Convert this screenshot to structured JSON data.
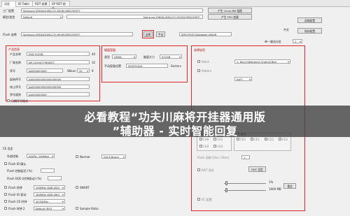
{
  "tabs": [
    "设定",
    "ID Table",
    "RDT 结果",
    "SP RDT 结果"
  ],
  "top": {
    "vendor_label": "工厂配置",
    "vendor_text": "Samsung,256Gb(4)MLC(2)-M(V6)(SM2259XT)",
    "controller_btn": "产生 Linux 8M 指图",
    "mode_label": "模型/类型",
    "mode_value": "Default",
    "ctrl_value": "Samsung,256Gb(4)MLC(2)-M(V6)(SM2259XT)",
    "fw_label": "Flash 选择",
    "fw_value": "Samsung,256Gb(4)MLC(2)-M(V6)(SM2259XT)",
    "gen_fpu_btn": "产生 FPU 档案",
    "auto_btn": "选择",
    "manual_btn": "手动",
    "db_text": "SM2259XT-Database.V8406",
    "load_btn": "读取配置",
    "lang_label": "中文",
    "save_btn": "保存配置",
    "mpfw_label": "单一量化分区",
    "mpfw_value": "1"
  },
  "product": {
    "title": "产品信息",
    "rows": [
      {
        "label": "产品名称",
        "value": "SSD 512GB",
        "num": "40"
      },
      {
        "label": "厂商名称",
        "value": "SM 2259XT PROJECT",
        "num": "32"
      },
      {
        "label": "序号",
        "value": "AA000000000",
        "num": "9"
      },
      {
        "label": "起始序号",
        "value": "AA000000000000000000",
        "num": ""
      },
      {
        "label": "终止序号",
        "value": "AA999999999999999999",
        "num": ""
      },
      {
        "label": "序号规则",
        "value": "AA000000000",
        "num": ""
      }
    ],
    "snlen_label": "SNLen",
    "snlen_value": "20",
    "auto_serial_label": "日期序号格式"
  },
  "disk": {
    "title": "磁盘容量",
    "type_label": "类型",
    "type_value": "GEMA",
    "size_label": "磁盘大小",
    "size_value": "512GB",
    "manual_label": "手动容量设置",
    "manual_value": "500374024",
    "sectors_label": "Sectors"
  },
  "right": {
    "title": "选择选项",
    "option1": "Patch",
    "option1_value": "1: Don't Reference Original Bad",
    "option2": "Pattern",
    "option3_value": "0xFF",
    "section2": "CE/Channel",
    "ce_label": "CE 被选",
    "ch_label": "CH 被选",
    "ce_boxes": [
      "CE0",
      "CE1",
      "CE2",
      "CE3"
    ],
    "ch_boxes": [
      "CH0",
      "CH1",
      "CH2",
      "CH3"
    ],
    "tag_label": "Flash 读取 (Ons / Ohm)",
    "tag_value": "1",
    "rdt_label": "RDT 测试",
    "rdt_btn": "RDT 设定",
    "slider1_value": "1%",
    "slider2_value": "1000 MB",
    "reset_btn": "重设",
    "more_label": "SC 配置"
  },
  "left_lower": {
    "section_title": "CE 设定",
    "rows": [
      "外部控制",
      "Flash ID 确认",
      "Flash 控制延迟 (%)",
      "Flash DQS (时钟驱动) (%)"
    ],
    "values": [
      "ASATA / HalfSlot",
      "",
      "",
      ""
    ],
    "bottom_rows": [
      "Flash 时钟",
      "Flash IO 驱动",
      "Flash CE 时钟",
      "Flash 时钟 2"
    ],
    "bottom_values": [
      "190MHz (SDR-400)",
      "180MHz (SDR-360)",
      "42/33MHz",
      "Default (R/S)"
    ]
  },
  "mid_lower": {
    "opt1": "Normal",
    "opt1_value": "Gen3.8Lane",
    "opt2": "SMART",
    "opt3": "Sample Ratio"
  },
  "overlay": {
    "line1": "必看教程“功夫川麻将开挂器通用版",
    "line2": "”辅助器 - 实时智能回复"
  }
}
